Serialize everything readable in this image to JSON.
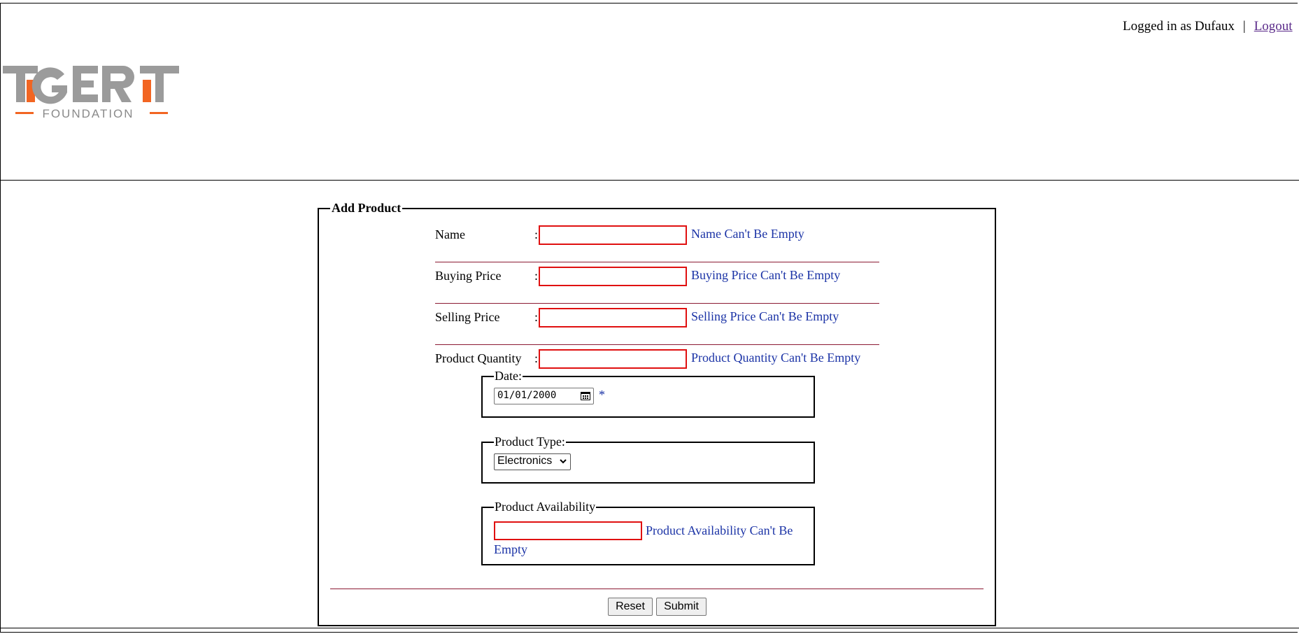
{
  "header": {
    "user_text": "Logged in as Dufaux",
    "separator": "|",
    "logout_label": "Logout",
    "logo": {
      "main": "TIGER IT",
      "sub": "FOUNDATION",
      "accent_color": "#f26522",
      "gray_color": "#9b9b9b"
    }
  },
  "form": {
    "legend": "Add Product",
    "fields": [
      {
        "label": "Name",
        "colon": ":",
        "value": "",
        "error": "Name Can't Be Empty"
      },
      {
        "label": "Buying Price",
        "colon": ":",
        "value": "",
        "error": "Buying Price Can't Be Empty"
      },
      {
        "label": "Selling Price",
        "colon": ":",
        "value": "",
        "error": "Selling Price Can't Be Empty"
      },
      {
        "label": "Product Quantity",
        "colon": ":",
        "value": "",
        "error": "Product Quantity Can't Be Empty"
      }
    ],
    "date": {
      "legend": "Date:",
      "value": "01/01/2000",
      "required_mark": "*"
    },
    "product_type": {
      "legend": "Product Type:",
      "selected": "Electronics"
    },
    "availability": {
      "legend": "Product Availability",
      "value": "",
      "error": "Product Availability Can't Be Empty"
    },
    "buttons": {
      "reset": "Reset",
      "submit": "Submit"
    }
  },
  "colors": {
    "error_text": "#1b33a6",
    "invalid_border": "#e01010",
    "rule": "#8b1a33",
    "link": "#5b2b8a"
  }
}
